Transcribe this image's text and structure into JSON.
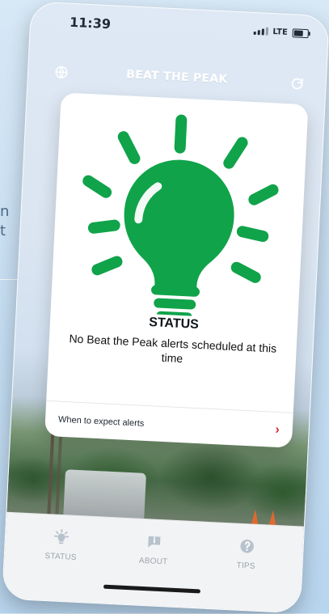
{
  "background": {
    "page_text_lines": [
      "n",
      "t"
    ]
  },
  "status_bar": {
    "time": "11:39",
    "network": "LTE"
  },
  "header": {
    "title": "BEAT THE PEAK",
    "left_icon": "globe-icon",
    "right_icon": "refresh-icon"
  },
  "status_card": {
    "illustration": "lightbulb-icon",
    "status_title": "STATUS",
    "status_message": "No Beat the Peak alerts scheduled at this time",
    "expect_row_label": "When to expect alerts",
    "expect_row_icon": "chevron-right-icon",
    "colors": {
      "bulb_green": "#10a34a",
      "accent_red": "#d72732"
    }
  },
  "tab_bar": {
    "items": [
      {
        "label": "STATUS",
        "icon": "sun-bulb-icon"
      },
      {
        "label": "ABOUT",
        "icon": "info-speech-icon"
      },
      {
        "label": "TIPS",
        "icon": "question-circle-icon"
      }
    ]
  }
}
